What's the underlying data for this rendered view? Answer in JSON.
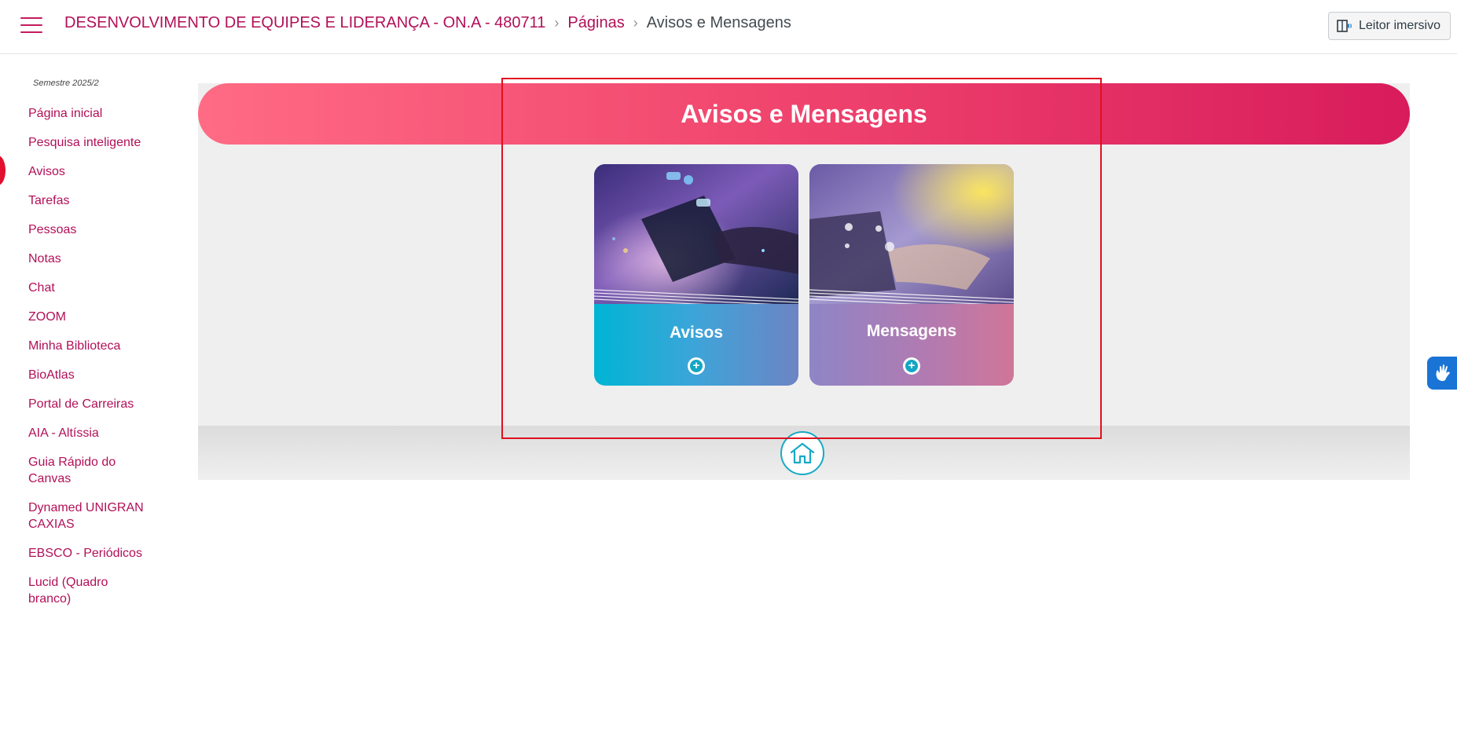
{
  "header": {
    "course_title": "DESENVOLVIMENTO DE EQUIPES E LIDERANÇA - ON.A - 480711",
    "breadcrumb_pages": "Páginas",
    "breadcrumb_current": "Avisos e Mensagens",
    "immersive_reader": "Leitor imersivo"
  },
  "sidebar": {
    "semester": "Semestre 2025/2",
    "items": [
      {
        "label": "Página inicial"
      },
      {
        "label": "Pesquisa inteligente"
      },
      {
        "label": "Avisos"
      },
      {
        "label": "Tarefas"
      },
      {
        "label": "Pessoas"
      },
      {
        "label": "Notas"
      },
      {
        "label": "Chat"
      },
      {
        "label": "ZOOM"
      },
      {
        "label": "Minha Biblioteca"
      },
      {
        "label": "BioAtlas"
      },
      {
        "label": "Portal de Carreiras"
      },
      {
        "label": "AIA - Altíssia"
      },
      {
        "label": "Guia Rápido do Canvas"
      },
      {
        "label": "Dynamed UNIGRAN CAXIAS"
      },
      {
        "label": "EBSCO - Periódicos"
      },
      {
        "label": "Lucid (Quadro branco)"
      }
    ]
  },
  "main": {
    "banner_title": "Avisos e Mensagens",
    "cards": [
      {
        "label": "Avisos",
        "icon": "plus-circle-icon"
      },
      {
        "label": "Mensagens",
        "icon": "plus-circle-icon"
      }
    ],
    "home_icon": "home-icon"
  },
  "colors": {
    "link": "#b21058",
    "banner_start": "#ff6b84",
    "banner_end": "#d81b5c",
    "accent_teal": "#17a9c6",
    "highlight": "#e0101e"
  }
}
